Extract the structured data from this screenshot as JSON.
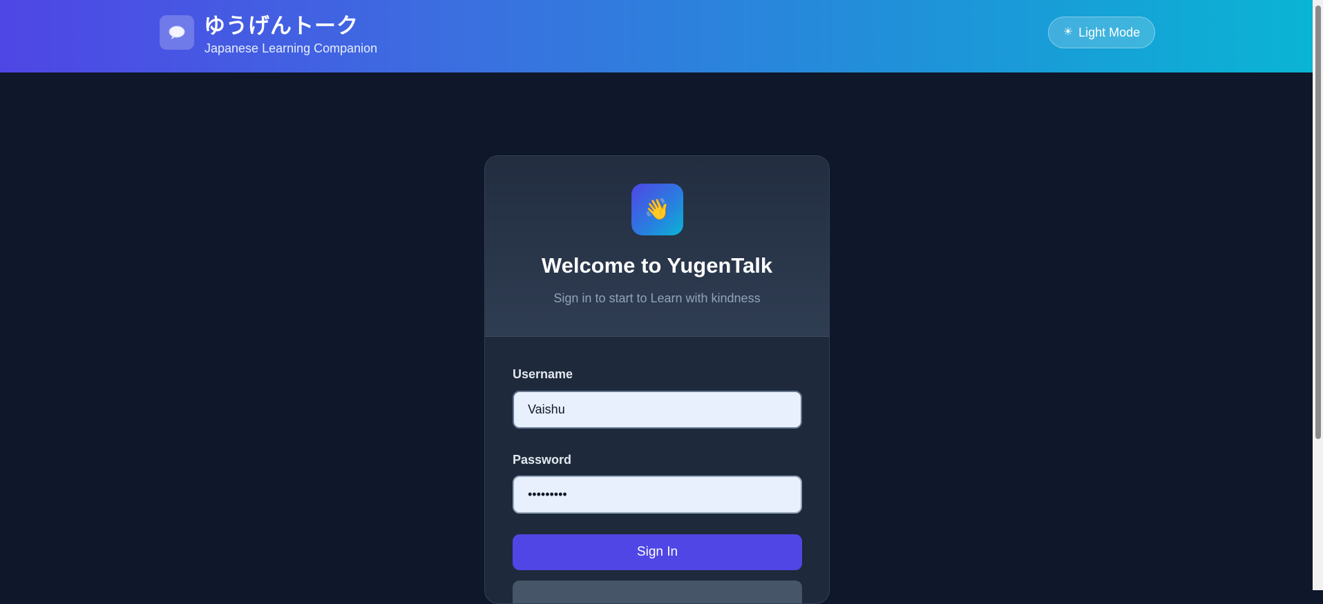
{
  "header": {
    "title": "ゆうげんトーク",
    "subtitle": "Japanese Learning Companion",
    "brand_icon": "speech-bubble-icon",
    "mode_button": {
      "icon": "sun-icon",
      "label": "Light Mode"
    }
  },
  "login_card": {
    "icon": "waving-hand-icon",
    "title": "Welcome to YugenTalk",
    "tagline": "Sign in to start to Learn with kindness",
    "username": {
      "label": "Username",
      "value": "Vaishu"
    },
    "password": {
      "label": "Password",
      "value": "•••••••••"
    },
    "signin_label": "Sign In"
  },
  "colors": {
    "background": "#0f172a",
    "card": "#1e293b",
    "primary": "#4f46e5",
    "header_start": "#4f46e5",
    "header_end": "#0ab4d4"
  }
}
